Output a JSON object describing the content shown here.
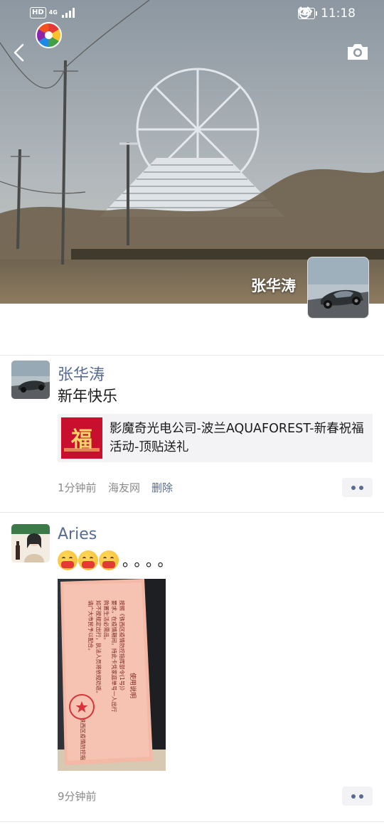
{
  "status_bar": {
    "hd": "HD",
    "network": "4G",
    "battery": "48",
    "time": "11:18"
  },
  "header": {
    "owner_name": "张华涛"
  },
  "icons": {
    "back": "back-arrow-icon",
    "camera": "camera-icon",
    "eye": "eye-comfort-icon",
    "alarm": "alarm-clock-icon",
    "more": "more-dots-icon"
  },
  "posts": [
    {
      "author": "张华涛",
      "text": "新年快乐",
      "share": {
        "thumb_char": "福",
        "title": "影魔奇光电公司-波兰AQUAFOREST-新春祝福活动-顶贴送礼"
      },
      "time": "1分钟前",
      "source": "海友网",
      "delete_label": "删除"
    },
    {
      "author": "Aries",
      "emoji_count": 3,
      "trailing_text": "。。。。",
      "photo_card": {
        "title": "使用说明",
        "lines": [
          "按照《铁西区疫情防控指挥部令(1号)》",
          "要求，在疫情期间，持此卡凭家庭单号一人出行",
          "购置生活必需品。",
          "如不按规定出行，执法人员将依规劝返。",
          "请广大市民予以配合。",
          "铁西区疫情防控指挥部"
        ]
      },
      "time": "9分钟前"
    }
  ],
  "colors": {
    "link_blue": "#576b95",
    "meta_gray": "#8a8a8a",
    "card_bg": "#f3f3f5"
  }
}
